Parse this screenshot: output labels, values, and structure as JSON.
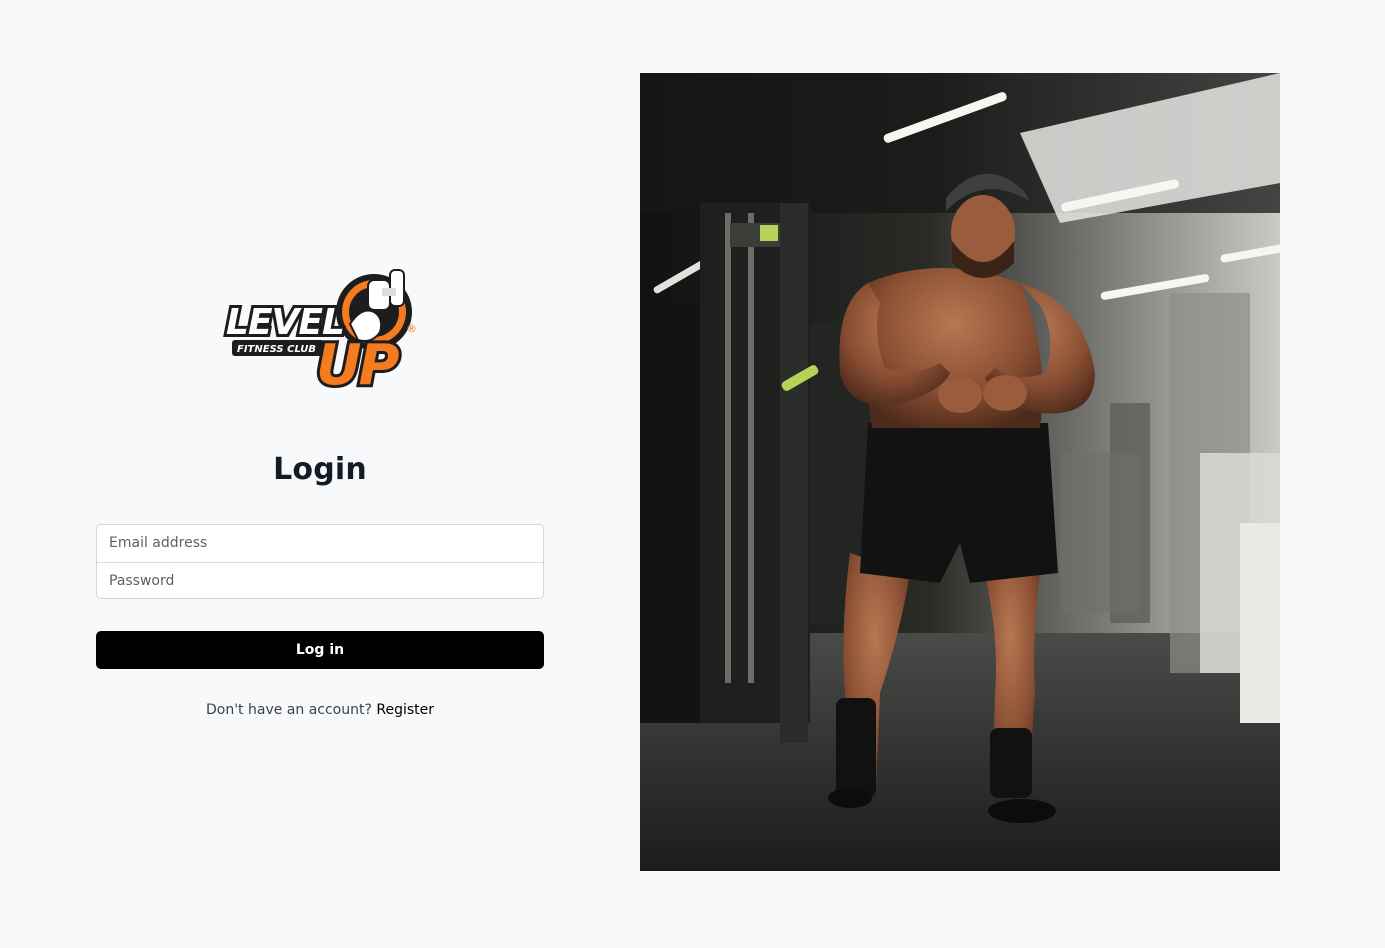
{
  "brand": {
    "logo_top": "LEVEL",
    "logo_sub": "FITNESS CLUB",
    "logo_big": "UP",
    "logo_mark": "®",
    "accent": "#f47b20",
    "icon": "dumbbell-arm-icon"
  },
  "login": {
    "title": "Login",
    "email_placeholder": "Email address",
    "password_placeholder": "Password",
    "submit_label": "Log in",
    "register_prompt": "Don't have an account?",
    "register_link": "Register"
  },
  "hero": {
    "subject": "bodybuilder-in-gym-photo"
  }
}
